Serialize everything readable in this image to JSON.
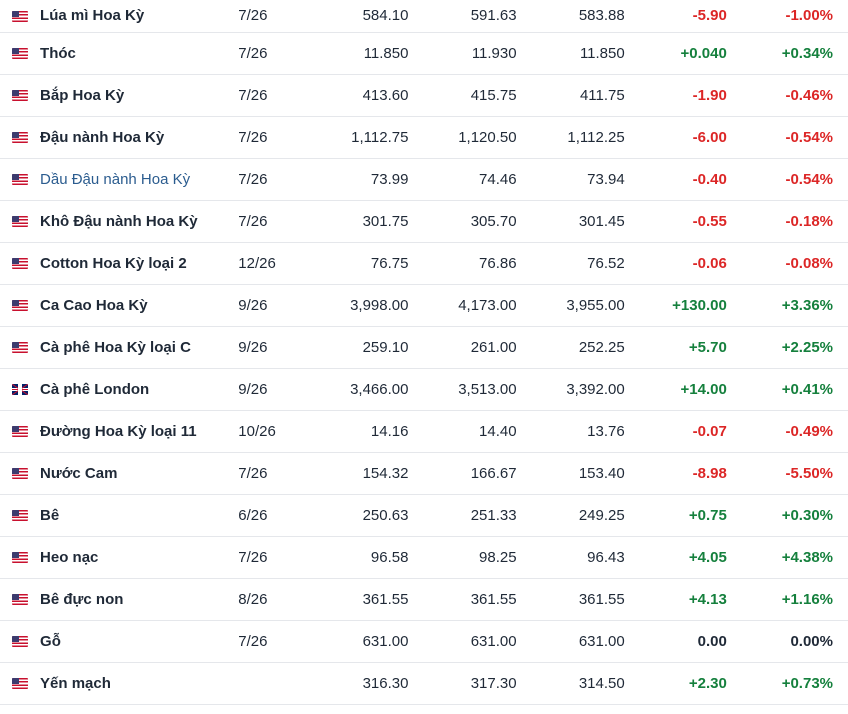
{
  "rows": [
    {
      "flag": "us",
      "name": "Lúa mì Hoa Kỳ",
      "month": "7/26",
      "last": "584.10",
      "high": "591.63",
      "low": "583.88",
      "chg": "-5.90",
      "pct": "-1.00%",
      "dir": "neg"
    },
    {
      "flag": "us",
      "name": "Thóc",
      "month": "7/26",
      "last": "11.850",
      "high": "11.930",
      "low": "11.850",
      "chg": "+0.040",
      "pct": "+0.34%",
      "dir": "pos"
    },
    {
      "flag": "us",
      "name": "Bắp Hoa Kỳ",
      "month": "7/26",
      "last": "413.60",
      "high": "415.75",
      "low": "411.75",
      "chg": "-1.90",
      "pct": "-0.46%",
      "dir": "neg"
    },
    {
      "flag": "us",
      "name": "Đậu nành Hoa Kỳ",
      "month": "7/26",
      "last": "1,112.75",
      "high": "1,120.50",
      "low": "1,112.25",
      "chg": "-6.00",
      "pct": "-0.54%",
      "dir": "neg"
    },
    {
      "flag": "us",
      "name": "Dầu Đậu nành Hoa Kỳ",
      "month": "7/26",
      "last": "73.99",
      "high": "74.46",
      "low": "73.94",
      "chg": "-0.40",
      "pct": "-0.54%",
      "dir": "neg",
      "link": true
    },
    {
      "flag": "us",
      "name": "Khô Đậu nành Hoa Kỳ",
      "month": "7/26",
      "last": "301.75",
      "high": "305.70",
      "low": "301.45",
      "chg": "-0.55",
      "pct": "-0.18%",
      "dir": "neg"
    },
    {
      "flag": "us",
      "name": "Cotton Hoa Kỳ loại 2",
      "month": "12/26",
      "last": "76.75",
      "high": "76.86",
      "low": "76.52",
      "chg": "-0.06",
      "pct": "-0.08%",
      "dir": "neg"
    },
    {
      "flag": "us",
      "name": "Ca Cao Hoa Kỳ",
      "month": "9/26",
      "last": "3,998.00",
      "high": "4,173.00",
      "low": "3,955.00",
      "chg": "+130.00",
      "pct": "+3.36%",
      "dir": "pos"
    },
    {
      "flag": "us",
      "name": "Cà phê Hoa Kỳ loại C",
      "month": "9/26",
      "last": "259.10",
      "high": "261.00",
      "low": "252.25",
      "chg": "+5.70",
      "pct": "+2.25%",
      "dir": "pos"
    },
    {
      "flag": "uk",
      "name": "Cà phê London",
      "month": "9/26",
      "last": "3,466.00",
      "high": "3,513.00",
      "low": "3,392.00",
      "chg": "+14.00",
      "pct": "+0.41%",
      "dir": "pos"
    },
    {
      "flag": "us",
      "name": "Đường Hoa Kỳ loại 11",
      "month": "10/26",
      "last": "14.16",
      "high": "14.40",
      "low": "13.76",
      "chg": "-0.07",
      "pct": "-0.49%",
      "dir": "neg"
    },
    {
      "flag": "us",
      "name": "Nước Cam",
      "month": "7/26",
      "last": "154.32",
      "high": "166.67",
      "low": "153.40",
      "chg": "-8.98",
      "pct": "-5.50%",
      "dir": "neg"
    },
    {
      "flag": "us",
      "name": "Bê",
      "month": "6/26",
      "last": "250.63",
      "high": "251.33",
      "low": "249.25",
      "chg": "+0.75",
      "pct": "+0.30%",
      "dir": "pos"
    },
    {
      "flag": "us",
      "name": "Heo nạc",
      "month": "7/26",
      "last": "96.58",
      "high": "98.25",
      "low": "96.43",
      "chg": "+4.05",
      "pct": "+4.38%",
      "dir": "pos"
    },
    {
      "flag": "us",
      "name": "Bê đực non",
      "month": "8/26",
      "last": "361.55",
      "high": "361.55",
      "low": "361.55",
      "chg": "+4.13",
      "pct": "+1.16%",
      "dir": "pos"
    },
    {
      "flag": "us",
      "name": "Gỗ",
      "month": "7/26",
      "last": "631.00",
      "high": "631.00",
      "low": "631.00",
      "chg": "0.00",
      "pct": "0.00%",
      "dir": "neu"
    },
    {
      "flag": "us",
      "name": "Yến mạch",
      "month": "",
      "last": "316.30",
      "high": "317.30",
      "low": "314.50",
      "chg": "+2.30",
      "pct": "+0.73%",
      "dir": "pos"
    }
  ],
  "colors": {
    "negative": "#dc2626",
    "positive": "#15803d",
    "link": "#2b5c8f"
  }
}
